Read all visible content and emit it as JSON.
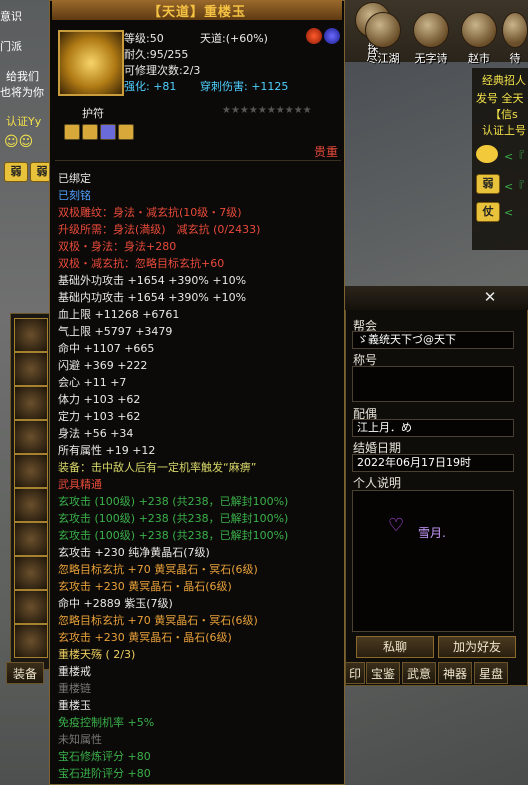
{
  "chat": {
    "lines": [
      "意识",
      "门派",
      "给我们",
      "也将为你",
      "认证Yy"
    ],
    "emote_labels": [
      "弱",
      "弱",
      "仗"
    ]
  },
  "topbar": {
    "items": [
      "探",
      "尽江湖",
      "无字诗",
      "赵市",
      "待"
    ]
  },
  "right_panel": {
    "lines": [
      "经典招人",
      "发号 全天",
      "【信s",
      "认证上号",
      "<『",
      "<『",
      "<"
    ]
  },
  "tooltip": {
    "title": "【天道】重楼玉",
    "level": "等级:50",
    "tiandao": "天道:(+60%)",
    "durability": "耐久:95/255",
    "repairable": "可修理次数:2/3",
    "strengthen": "强化: +81",
    "pierce": "穿刺伤害: +1125",
    "amulet_label": "护符",
    "stars": "★★★★★★★★★★",
    "value_tag": "贵重",
    "lines": [
      {
        "text": "已绑定",
        "color": "#e8e8e8"
      },
      {
        "text": "已刻铭",
        "color": "#4fa0ff"
      },
      {
        "text": "双极雕纹：身法・减玄抗(10级・7级)",
        "color": "#e84a3a"
      },
      {
        "text": "升级所需：身法(満级)　减玄抗 (0/2433)",
        "color": "#e84a3a"
      },
      {
        "text": "双极・身法：身法+280",
        "color": "#e84a3a"
      },
      {
        "text": "双极・减玄抗：忽略目标玄抗+60",
        "color": "#e84a3a"
      },
      {
        "text": "基础外功攻击 +1654 +390% +10%",
        "color": "#e8e8e8",
        "suffix": "+390% +10%"
      },
      {
        "text": "基础内功攻击 +1654 +390% +10%",
        "color": "#e8e8e8"
      },
      {
        "text": "血上限 +11268 +6761",
        "color": "#e8e8e8"
      },
      {
        "text": "气上限 +5797 +3479",
        "color": "#e8e8e8"
      },
      {
        "text": "命中 +1107 +665",
        "color": "#e8e8e8"
      },
      {
        "text": "闪避 +369 +222",
        "color": "#e8e8e8"
      },
      {
        "text": "会心 +11 +7",
        "color": "#e8e8e8"
      },
      {
        "text": "体力 +103 +62",
        "color": "#e8e8e8"
      },
      {
        "text": "定力 +103 +62",
        "color": "#e8e8e8"
      },
      {
        "text": "身法 +56 +34",
        "color": "#e8e8e8"
      },
      {
        "text": "所有属性 +19 +12",
        "color": "#e8e8e8"
      },
      {
        "text": "装备：击中敌人后有一定机率触发“麻痹”",
        "color": "#d8d86a"
      },
      {
        "text": "武具精通",
        "color": "#e84a3a"
      },
      {
        "text": "玄攻击 (100级) +238 (共238，已解封100%)",
        "color": "#3ab04a"
      },
      {
        "text": "玄攻击 (100级) +238 (共238，已解封100%)",
        "color": "#3ab04a"
      },
      {
        "text": "玄攻击 (100级) +238 (共238，已解封100%)",
        "color": "#3ab04a"
      },
      {
        "text": "玄攻击 +230 纯净黄晶石(7级)",
        "color": "#e8e8e8"
      },
      {
        "text": "忽略目标玄抗 +70 黄冥晶石・冥石(6级)",
        "color": "#e8a03a"
      },
      {
        "text": "玄攻击 +230 黄冥晶石・晶石(6级)",
        "color": "#e8a03a"
      },
      {
        "text": "命中 +2889 紫玉(7级)",
        "color": "#e8e8e8"
      },
      {
        "text": "忽略目标玄抗 +70 黄冥晶石・冥石(6级)",
        "color": "#e8a03a"
      },
      {
        "text": "玄攻击 +230 黄冥晶石・晶石(6级)",
        "color": "#e8a03a"
      },
      {
        "text": "重楼天殇 ( 2/3)",
        "color": "#f0d060"
      },
      {
        "text": "重楼戒",
        "color": "#e8e8e8"
      },
      {
        "text": "重楼链",
        "color": "#777"
      },
      {
        "text": "重楼玉",
        "color": "#e8e8e8"
      },
      {
        "text": "免疫控制机率 +5%",
        "color": "#3ab04a"
      },
      {
        "text": "未知属性",
        "color": "#777"
      },
      {
        "text": "宝石修炼评分 +80",
        "color": "#3ab04a"
      },
      {
        "text": "宝石进阶评分 +80",
        "color": "#3ab04a"
      }
    ]
  },
  "equip_tab_label": "装备",
  "dialog": {
    "guild_label": "帮会",
    "guild_value": "ゞ義统天下づ@天下",
    "title_label": "称号",
    "spouse_label": "配偶",
    "spouse_value": "江上月．め",
    "wedding_label": "结婚日期",
    "wedding_value": "2022年06月17日19时",
    "bio_label": "个人说明",
    "bio_name": "雪月.",
    "chat_button": "私聊",
    "add_friend_button": "加为好友",
    "tabs": [
      "印",
      "宝鉴",
      "武意",
      "神器",
      "星盘"
    ]
  }
}
